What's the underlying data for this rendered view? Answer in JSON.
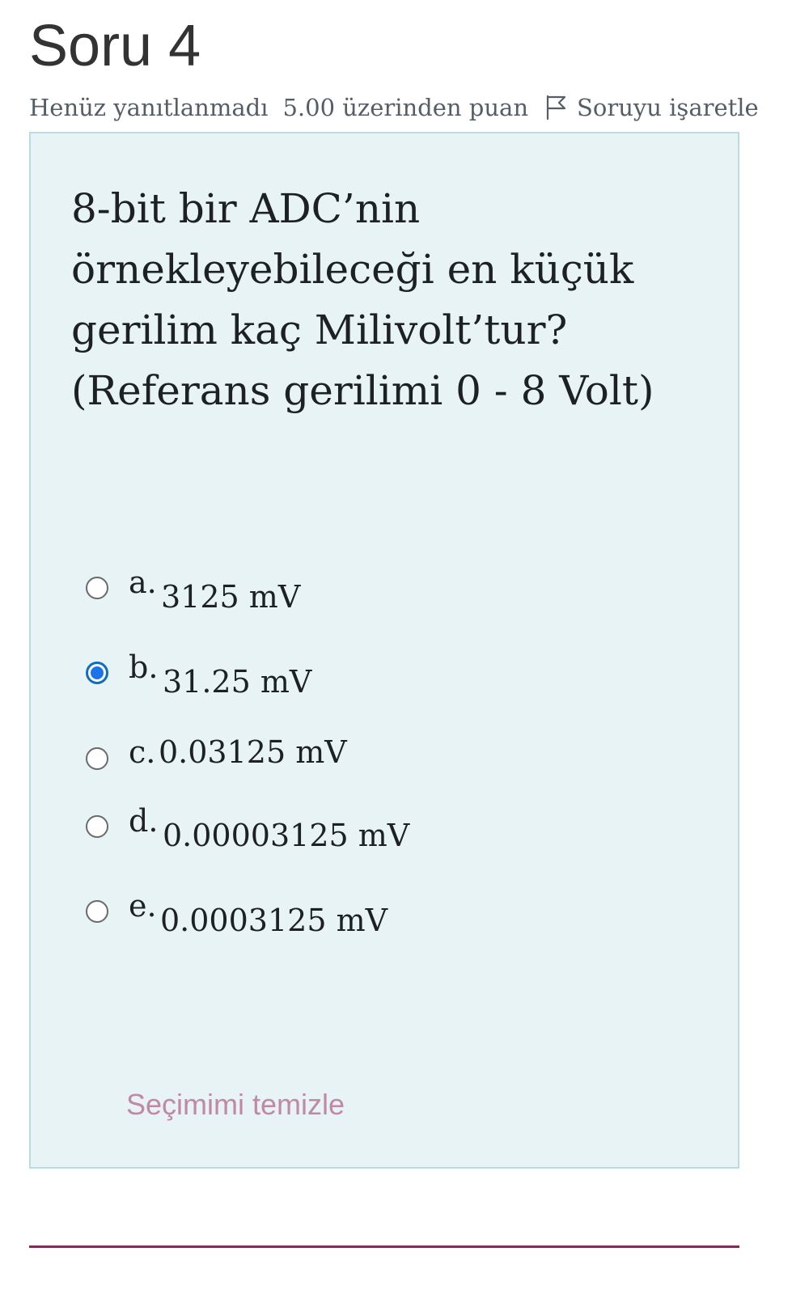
{
  "question": {
    "title": "Soru 4",
    "status": "Henüz yanıtlanmadı",
    "points": "5.00 üzerinden puan",
    "flag_label": "Soruyu işaretle",
    "text_lines": [
      "8-bit bir ADC’nin",
      "örnekleyebileceği en küçük",
      "gerilim kaç Milivolt’tur?",
      "(Referans gerilimi 0 - 8 Volt)"
    ],
    "options": [
      {
        "letter": "a.",
        "text": "3125 mV",
        "selected": false
      },
      {
        "letter": "b.",
        "text": "31.25 mV",
        "selected": true
      },
      {
        "letter": "c.",
        "text": "0.03125 mV",
        "selected": false
      },
      {
        "letter": "d.",
        "text": "0.00003125 mV",
        "selected": false
      },
      {
        "letter": "e.",
        "text": "0.0003125 mV",
        "selected": false
      }
    ],
    "clear_label": "Seçimimi temizle"
  },
  "icons": {
    "flag": "flag-icon",
    "radio_selected_color": "#1a73e8"
  }
}
